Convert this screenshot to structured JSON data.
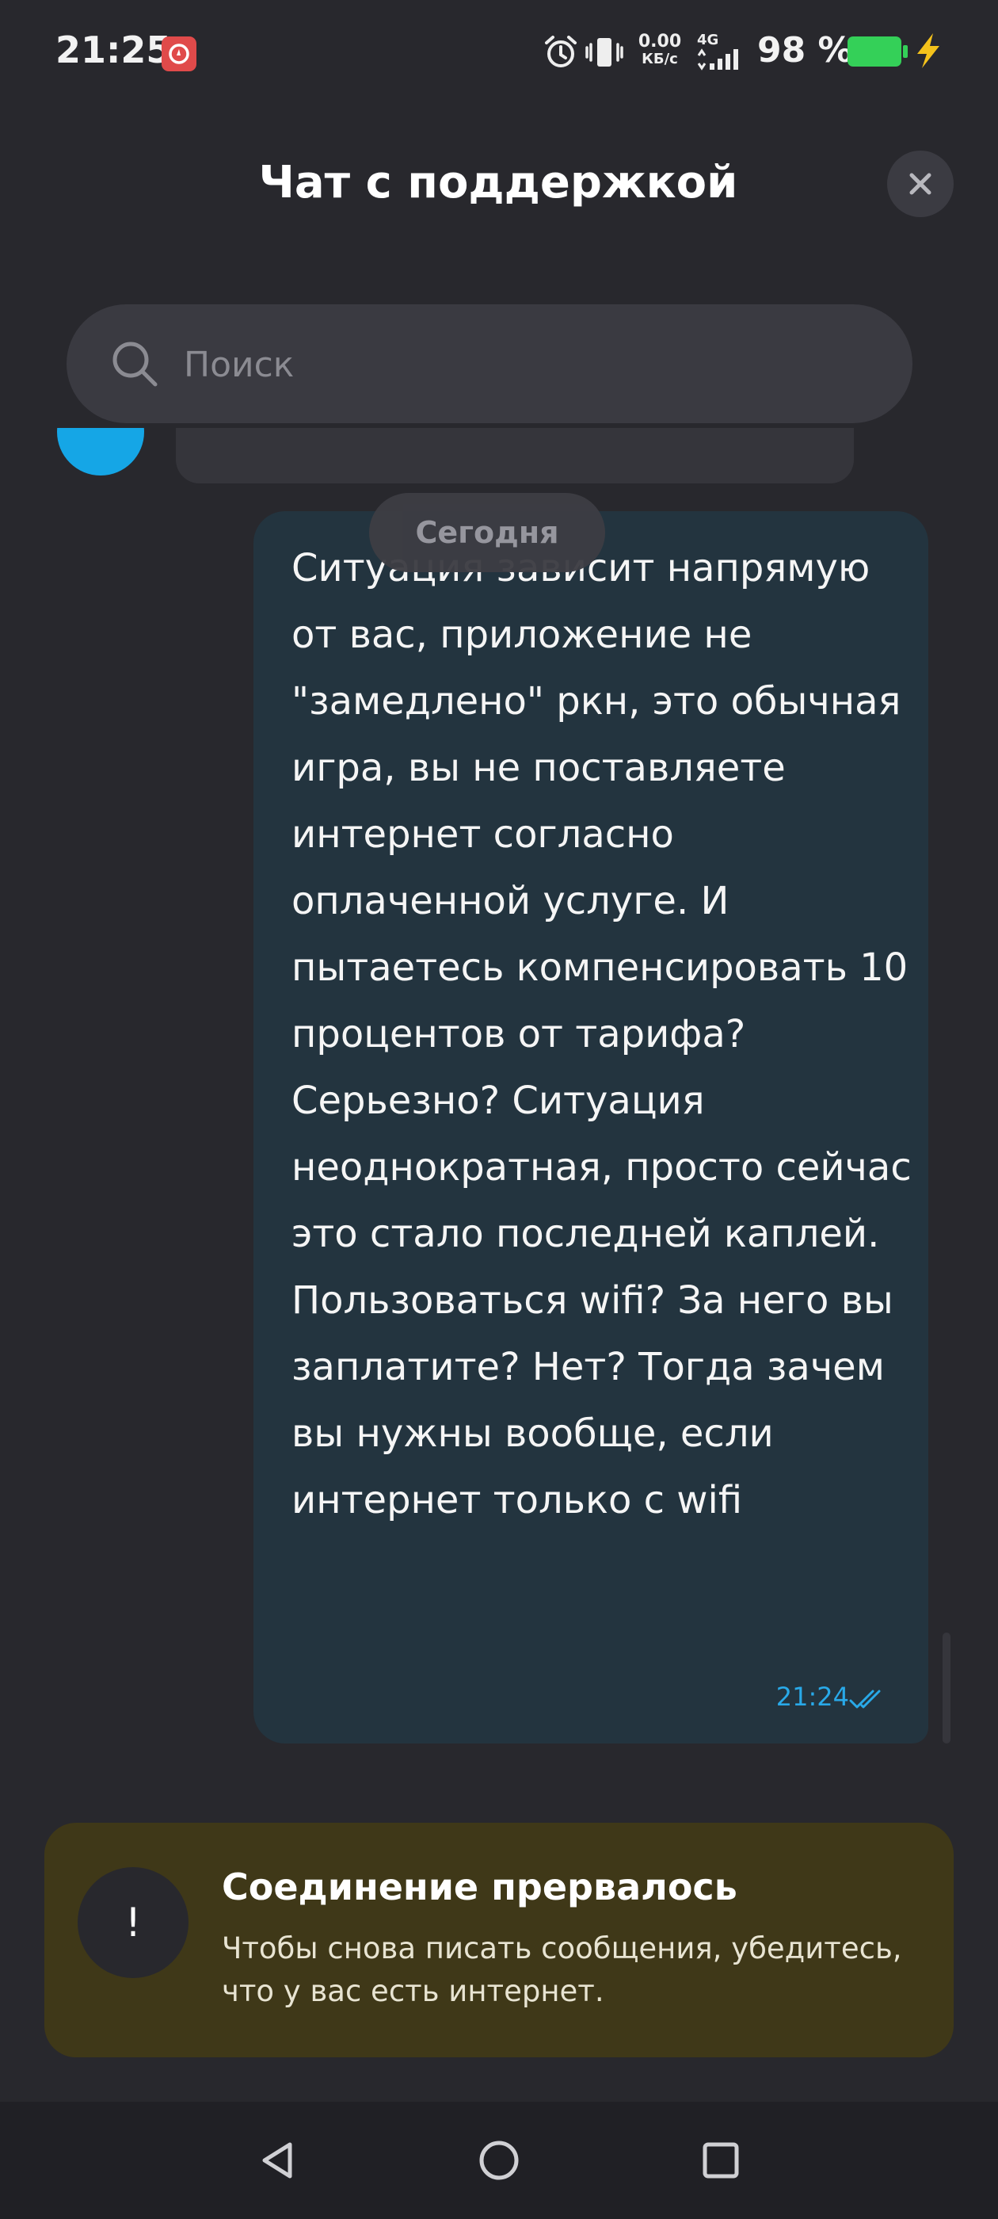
{
  "status_bar": {
    "time": "21:25",
    "net_speed_value": "0.00",
    "net_speed_unit": "КБ/с",
    "network_type": "4G",
    "battery_percent": "98 %",
    "icons": [
      "app-notification-icon",
      "alarm-icon",
      "vibrate-icon",
      "signal-icon",
      "battery-icon",
      "charging-icon"
    ]
  },
  "header": {
    "title": "Чат с поддержкой",
    "close_icon": "close-icon"
  },
  "search": {
    "placeholder": "Поиск",
    "value": ""
  },
  "chat": {
    "date_label": "Сегодня",
    "message": {
      "text": "Ситуация зависит напрямую от вас, приложение не \"замедлено\" ркн, это обычная игра, вы не поставляете интернет согласно оплаченной услуге. И пытаетесь компенсировать 10 процентов от тарифа? Серьезно? Ситуация неоднократная, просто сейчас это стало последней каплей. Пользоваться wifi? За него вы заплатите? Нет? Тогда зачем вы нужны вообще, если интернет только с wifi",
      "time": "21:24",
      "status_icon": "double-check-icon"
    }
  },
  "error_banner": {
    "icon": "!",
    "title": "Соединение прервалось",
    "text": "Чтобы снова писать сообщения, убедитесь, что у вас есть интернет."
  },
  "nav_bar": {
    "icons": [
      "back-icon",
      "home-icon",
      "recents-icon"
    ]
  },
  "colors": {
    "background": "#28282d",
    "bubble": "#23343f",
    "accent": "#29a9e8",
    "banner": "#3f3818",
    "battery": "#34d058"
  }
}
